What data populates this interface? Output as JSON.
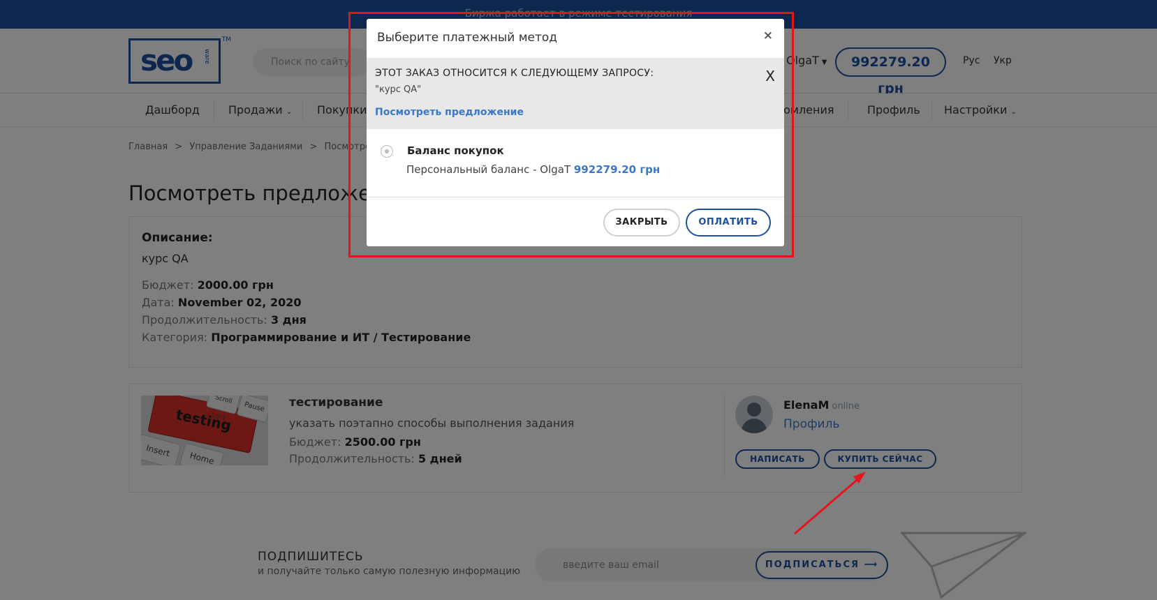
{
  "topbar": {
    "notice": "Биржа работает в режиме тестирования"
  },
  "header": {
    "logo_text": "seo",
    "logo_sub": "ware",
    "logo_tm": "TM",
    "search_placeholder": "Поиск по сайту",
    "username": "OlgaT",
    "balance": "992279.20 грн",
    "lang_ru": "Рус",
    "lang_ua": "Укр"
  },
  "nav": {
    "items": [
      "Дашборд",
      "Продажи",
      "Покупки",
      "Уведомления",
      "Профиль",
      "Настройки"
    ]
  },
  "breadcrumb": {
    "home": "Главная",
    "sep": ">",
    "tasks": "Управление Заданиями",
    "current": "Посмотреть предложение"
  },
  "page": {
    "title": "Посмотреть предложение"
  },
  "description": {
    "heading": "Описание:",
    "text": "курс QA",
    "budget_label": "Бюджет:",
    "budget_value": "2000.00 грн",
    "date_label": "Дата:",
    "date_value": "November 02, 2020",
    "duration_label": "Продолжительность:",
    "duration_value": "3 дня",
    "category_label": "Категория:",
    "category_value": "Программирование и ИТ / Тестирование"
  },
  "offer": {
    "image_keys": [
      "Insert",
      "Home",
      "Pause",
      "Scroll Lock",
      "testing"
    ],
    "title": "тестирование",
    "desc": "указать поэтапно способы выполнения задания",
    "budget_label": "Бюджет:",
    "budget_value": "2500.00 грн",
    "duration_label": "Продолжительность:",
    "duration_value": "5 дней",
    "seller_name": "ElenaM",
    "seller_status": "online",
    "seller_profile": "Профиль",
    "btn_write": "НАПИСАТЬ",
    "btn_buy": "КУПИТЬ СЕЙЧАС"
  },
  "subscribe": {
    "title": "ПОДПИШИТЕСЬ",
    "text": "и получайте только самую полезную информацию",
    "email_placeholder": "введите ваш email",
    "button": "ПОДПИСАТЬСЯ"
  },
  "modal": {
    "title": "Выберите платежный метод",
    "close_x": "×",
    "info_heading": "ЭТОТ ЗАКАЗ ОТНОСИТСЯ К СЛЕДУЮЩЕМУ ЗАПРОСУ:",
    "info_query": "\"курс QA\"",
    "info_link": "Посмотреть предложение",
    "info_close": "X",
    "method_label": "Баланс покупок",
    "personal_label": "Персональный баланс - OlgaT",
    "personal_value": "992279.20 грн",
    "btn_close": "ЗАКРЫТЬ",
    "btn_pay": "ОПЛАТИТЬ"
  },
  "colors": {
    "brand": "#1d4f9c",
    "link": "#3a78c9",
    "annotation": "#e1151b"
  }
}
